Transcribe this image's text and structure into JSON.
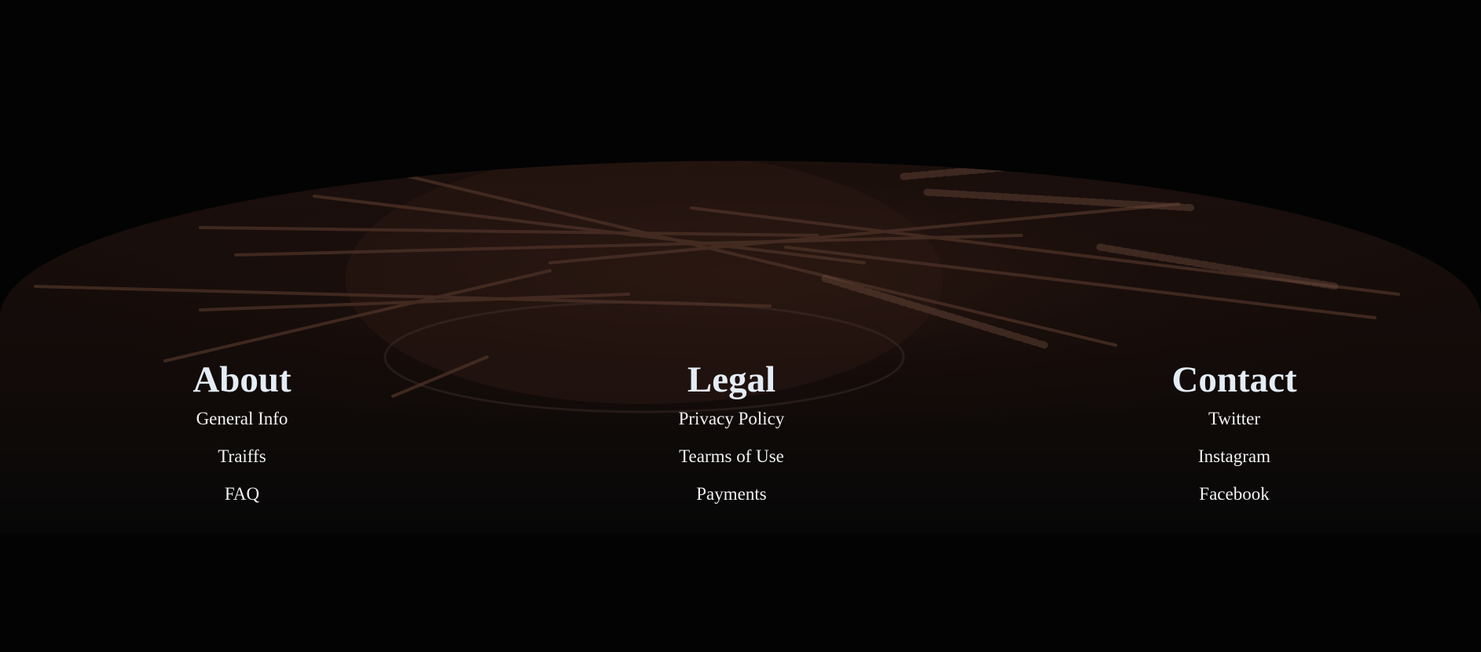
{
  "footer": {
    "columns": [
      {
        "heading": "About",
        "links": [
          "General Info",
          "Traiffs",
          "FAQ"
        ]
      },
      {
        "heading": "Legal",
        "links": [
          "Privacy Policy",
          "Tearms of Use",
          "Payments"
        ]
      },
      {
        "heading": "Contact",
        "links": [
          "Twitter",
          "Instagram",
          "Facebook"
        ]
      }
    ]
  },
  "colors": {
    "page_background": "#030303",
    "heading_text": "#e4ecf5",
    "link_text": "#f2f2f2"
  }
}
